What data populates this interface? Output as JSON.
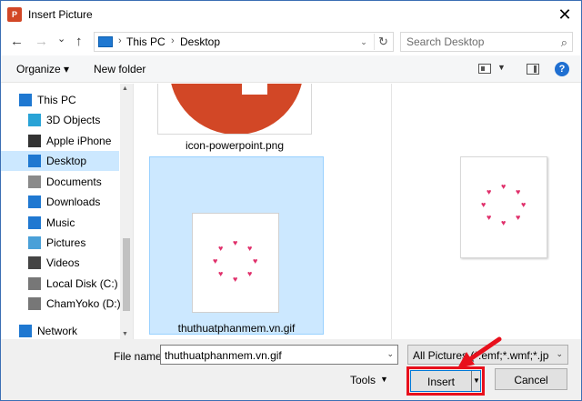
{
  "window": {
    "app_icon_text": "P",
    "title": "Insert Picture",
    "close_glyph": "✕"
  },
  "nav": {
    "back_glyph": "←",
    "forward_glyph": "→",
    "recent_glyph": "⌄",
    "up_glyph": "↑",
    "breadcrumb": [
      "This PC",
      "Desktop"
    ],
    "breadcrumb_sep": "›",
    "dropdown_glyph": "⌄",
    "refresh_glyph": "↻"
  },
  "search": {
    "placeholder": "Search Desktop",
    "icon_glyph": "⌕"
  },
  "toolbar": {
    "organize_label": "Organize ▾",
    "new_folder_label": "New folder",
    "view_dropdown_glyph": "▼",
    "help_glyph": "?"
  },
  "sidebar": {
    "items": [
      {
        "label": "This PC",
        "icon": "pc-icon",
        "color": "#1f78d1"
      },
      {
        "label": "3D Objects",
        "icon": "cube-icon",
        "color": "#29a3d6"
      },
      {
        "label": "Apple iPhone",
        "icon": "phone-icon",
        "color": "#333333"
      },
      {
        "label": "Desktop",
        "icon": "desktop-icon",
        "color": "#1f78d1"
      },
      {
        "label": "Documents",
        "icon": "documents-icon",
        "color": "#8a8a8a"
      },
      {
        "label": "Downloads",
        "icon": "downloads-icon",
        "color": "#1f78d1"
      },
      {
        "label": "Music",
        "icon": "music-icon",
        "color": "#1f78d1"
      },
      {
        "label": "Pictures",
        "icon": "pictures-icon",
        "color": "#4aa0d8"
      },
      {
        "label": "Videos",
        "icon": "videos-icon",
        "color": "#444444"
      },
      {
        "label": "Local Disk (C:)",
        "icon": "disk-icon",
        "color": "#777777"
      },
      {
        "label": "ChamYoko (D:)",
        "icon": "disk-icon",
        "color": "#777777"
      },
      {
        "label": "Network",
        "icon": "network-icon",
        "color": "#1f78d1"
      }
    ],
    "selected_index": 3
  },
  "files": [
    {
      "name": "icon-powerpoint.png",
      "selected": false
    },
    {
      "name": "thuthuatphanmem.vn.gif",
      "selected": true
    }
  ],
  "bottom": {
    "filename_label": "File name:",
    "filename_value": "thuthuatphanmem.vn.gif",
    "filter_value": "All Pictures (*.emf;*.wmf;*.jpg;*",
    "tools_label": "Tools",
    "insert_label": "Insert",
    "cancel_label": "Cancel",
    "dropdown_glyph": "⌄"
  },
  "colors": {
    "accent": "#0078d7",
    "selection": "#cce8ff",
    "highlight_box": "#e8101c",
    "heart": "#e0306b",
    "powerpoint": "#d24726"
  }
}
